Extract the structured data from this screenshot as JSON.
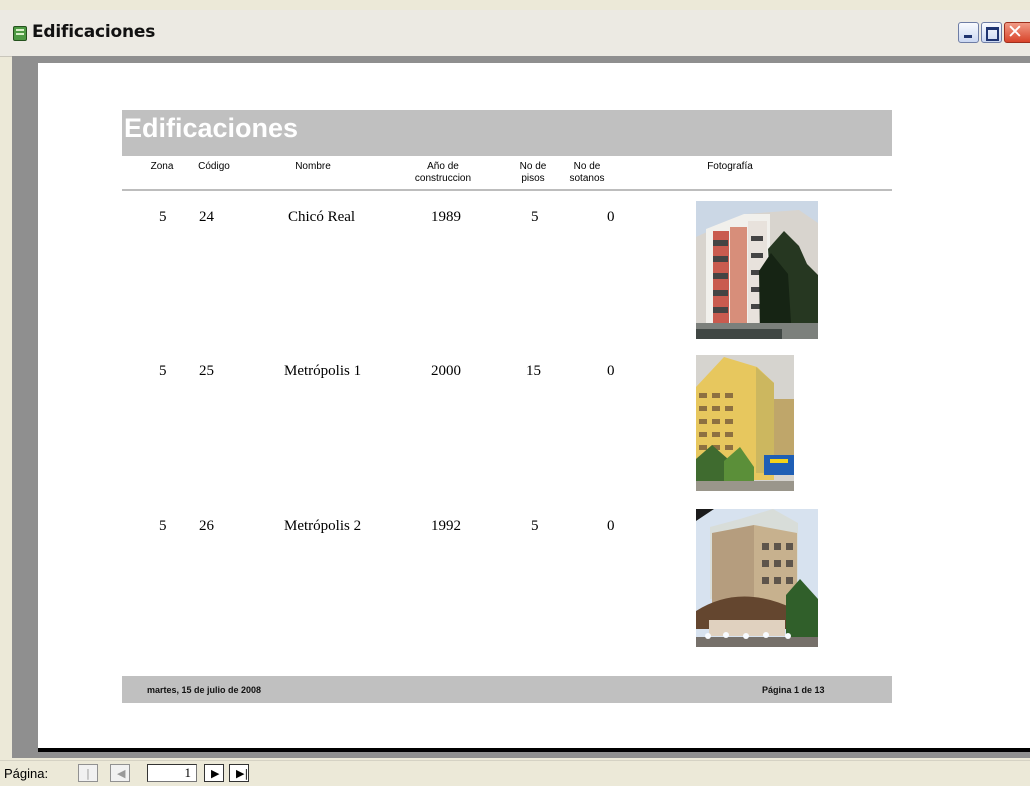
{
  "window": {
    "title": "Edificaciones",
    "icon": "report-icon"
  },
  "report": {
    "title": "Edificaciones",
    "columns": [
      {
        "label": "Zona"
      },
      {
        "label": "Código"
      },
      {
        "label": "Nombre"
      },
      {
        "label": "Año de construccion"
      },
      {
        "label": "No de pisos"
      },
      {
        "label": "No de sotanos"
      },
      {
        "label": "Fotografía"
      }
    ],
    "rows": [
      {
        "zona": "5",
        "codigo": "24",
        "nombre": "Chicó Real",
        "anio": "1989",
        "pisos": "5",
        "sotanos": "0",
        "photo": "building-photo-chico-real"
      },
      {
        "zona": "5",
        "codigo": "25",
        "nombre": "Metrópolis 1",
        "anio": "2000",
        "pisos": "15",
        "sotanos": "0",
        "photo": "building-photo-metropolis-1"
      },
      {
        "zona": "5",
        "codigo": "26",
        "nombre": "Metrópolis 2",
        "anio": "1992",
        "pisos": "5",
        "sotanos": "0",
        "photo": "building-photo-metropolis-2"
      }
    ],
    "footer": {
      "date": "martes, 15 de julio de 2008",
      "page": "Página 1 de 13"
    }
  },
  "navigation": {
    "label": "Página:",
    "current_page": "1",
    "buttons": [
      "first-page-icon",
      "previous-page-icon",
      "next-page-icon",
      "last-page-icon"
    ]
  },
  "colors": {
    "report_band": "#c0c0c0",
    "report_title": "#ffffff",
    "preview_background": "#8f8f8f",
    "window_chrome": "#ece9d8",
    "close_button": "#d8442a"
  }
}
